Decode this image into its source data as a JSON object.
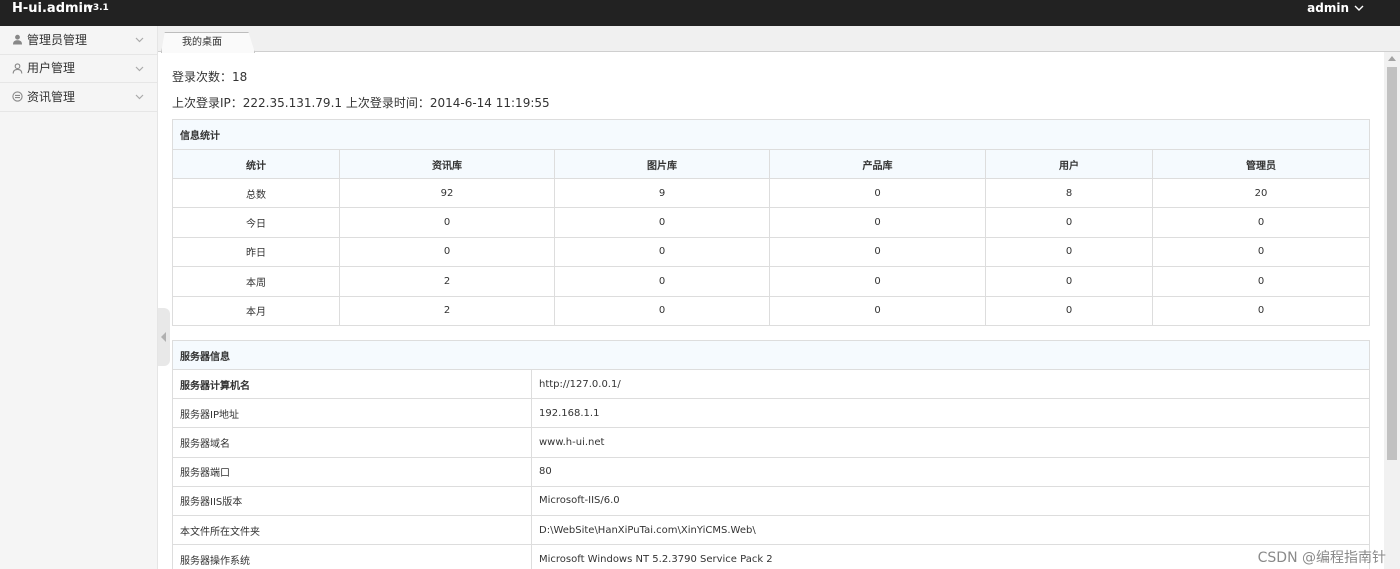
{
  "header": {
    "brand": "H-ui.admin",
    "version": "v3.1",
    "user": "admin",
    "user_menu_icon": "chevron-down-icon"
  },
  "sidebar": {
    "items": [
      {
        "label": "管理员管理",
        "icon": "admin-user-icon"
      },
      {
        "label": "用户管理",
        "icon": "user-icon"
      },
      {
        "label": "资讯管理",
        "icon": "news-icon"
      }
    ]
  },
  "tabs": [
    {
      "label": "我的桌面"
    }
  ],
  "main": {
    "login_count": "登录次数：18",
    "login_info": "上次登录IP：222.35.131.79.1 上次登录时间：2014-6-14 11:19:55"
  },
  "stats_table": {
    "caption": "信息统计",
    "headers": [
      "统计",
      "资讯库",
      "图片库",
      "产品库",
      "用户",
      "管理员"
    ],
    "rows": [
      [
        "总数",
        "92",
        "9",
        "0",
        "8",
        "20"
      ],
      [
        "今日",
        "0",
        "0",
        "0",
        "0",
        "0"
      ],
      [
        "昨日",
        "0",
        "0",
        "0",
        "0",
        "0"
      ],
      [
        "本周",
        "2",
        "0",
        "0",
        "0",
        "0"
      ],
      [
        "本月",
        "2",
        "0",
        "0",
        "0",
        "0"
      ]
    ]
  },
  "server_table": {
    "caption": "服务器信息",
    "rows": [
      [
        "服务器计算机名",
        "http://127.0.0.1/"
      ],
      [
        "服务器IP地址",
        "192.168.1.1"
      ],
      [
        "服务器域名",
        "www.h-ui.net"
      ],
      [
        "服务器端口",
        "80"
      ],
      [
        "服务器IIS版本",
        "Microsoft-IIS/6.0"
      ],
      [
        "本文件所在文件夹",
        "D:\\WebSite\\HanXiPuTai.com\\XinYiCMS.Web\\"
      ],
      [
        "服务器操作系统",
        "Microsoft Windows NT 5.2.3790 Service Pack 2"
      ]
    ]
  },
  "watermark": "CSDN @编程指南针",
  "colors": {
    "topbar": "#222222",
    "sidebar": "#f5f5f5",
    "table_header": "#f5fafe",
    "border": "#dddddd"
  }
}
